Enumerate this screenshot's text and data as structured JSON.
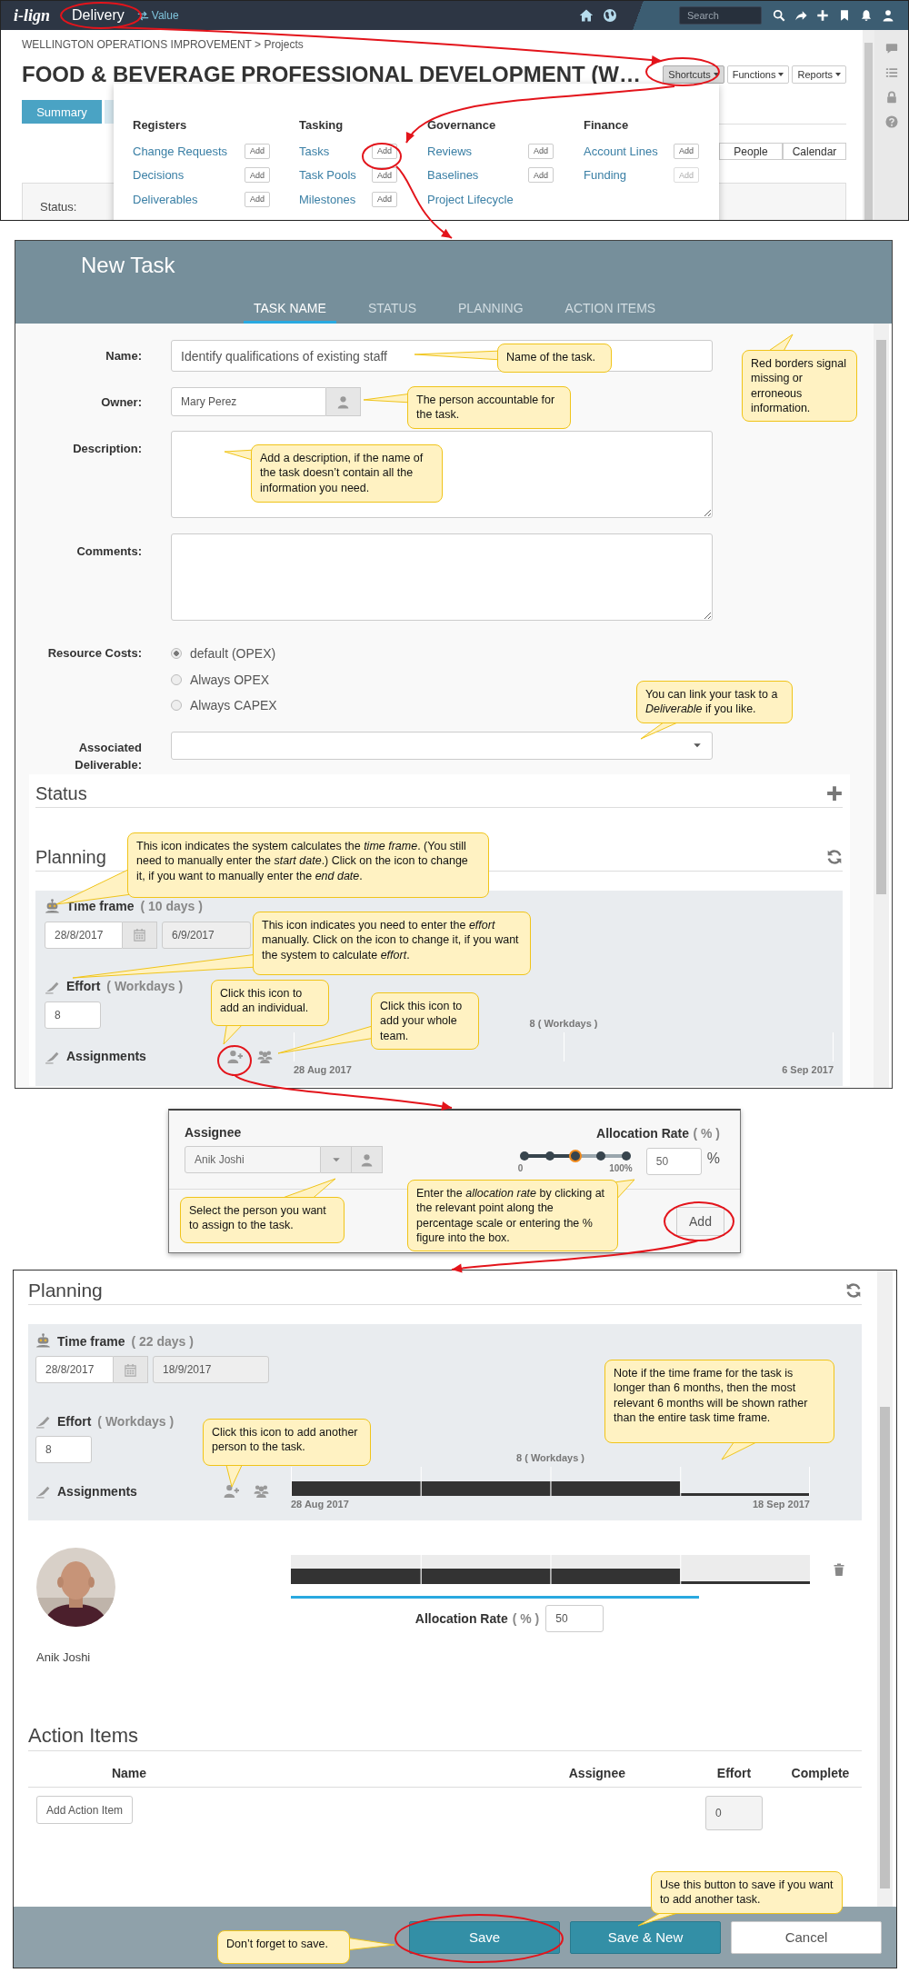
{
  "top": {
    "logo": "i-lign",
    "module": "Delivery",
    "switch_label": "Value",
    "search": {
      "placeholder": "Search"
    },
    "breadcrumb": "WELLINGTON OPERATIONS IMPROVEMENT > Projects",
    "title": "FOOD & BEVERAGE PROFESSIONAL DEVELOPMENT (W…",
    "menu_buttons": [
      {
        "label": "Shortcuts",
        "open": true
      },
      {
        "label": "Functions",
        "open": false
      },
      {
        "label": "Reports",
        "open": false
      }
    ],
    "tabs": [
      {
        "label": "Summary",
        "selected": true
      }
    ],
    "view_buttons": [
      "People",
      "Calendar"
    ],
    "status_label": "Status:"
  },
  "shortcuts_menu": {
    "columns": [
      {
        "heading": "Registers",
        "items": [
          {
            "label": "Change Requests",
            "add": {
              "label": "Add",
              "disabled": false
            }
          },
          {
            "label": "Decisions",
            "add": {
              "label": "Add",
              "disabled": false
            }
          },
          {
            "label": "Deliverables",
            "add": {
              "label": "Add",
              "disabled": false
            }
          }
        ]
      },
      {
        "heading": "Tasking",
        "items": [
          {
            "label": "Tasks",
            "add": {
              "label": "Add",
              "disabled": false
            }
          },
          {
            "label": "Task Pools",
            "add": {
              "label": "Add",
              "disabled": false
            }
          },
          {
            "label": "Milestones",
            "add": {
              "label": "Add",
              "disabled": false
            }
          }
        ]
      },
      {
        "heading": "Governance",
        "items": [
          {
            "label": "Reviews",
            "add": {
              "label": "Add",
              "disabled": false
            }
          },
          {
            "label": "Baselines",
            "add": {
              "label": "Add",
              "disabled": false
            }
          },
          {
            "label": "Project Lifecycle"
          }
        ]
      },
      {
        "heading": "Finance",
        "items": [
          {
            "label": "Account Lines",
            "add": {
              "label": "Add",
              "disabled": false
            }
          },
          {
            "label": "Funding",
            "add": {
              "label": "Add",
              "disabled": true
            }
          }
        ]
      }
    ]
  },
  "new_task": {
    "title": "New Task",
    "tabs": [
      {
        "label": "TASK NAME",
        "selected": true
      },
      {
        "label": "STATUS",
        "selected": false
      },
      {
        "label": "PLANNING",
        "selected": false
      },
      {
        "label": "ACTION ITEMS",
        "selected": false
      }
    ],
    "name": {
      "label": "Name:",
      "value": "Identify qualifications of existing staff"
    },
    "owner": {
      "label": "Owner:",
      "value": "Mary Perez"
    },
    "description": {
      "label": "Description:"
    },
    "comments": {
      "label": "Comments:"
    },
    "resource_costs": {
      "label": "Resource Costs:",
      "options": [
        {
          "label": "default (OPEX)",
          "selected": true
        },
        {
          "label": "Always OPEX",
          "selected": false
        },
        {
          "label": "Always CAPEX",
          "selected": false
        }
      ]
    },
    "deliverable": {
      "label": "Associated Deliverable:"
    },
    "status_heading": "Status",
    "planning": {
      "heading": "Planning",
      "time_frame": {
        "label": "Time frame",
        "duration": "( 10 days )",
        "start": "28/8/2017",
        "end": "6/9/2017"
      },
      "effort": {
        "label": "Effort",
        "unit": "( Workdays )",
        "value": "8"
      },
      "assignments": {
        "label": "Assignments",
        "total": "8 ( Workdays )",
        "from": "28 Aug 2017",
        "to": "6 Sep 2017"
      }
    }
  },
  "assign_popup": {
    "assignee_label": "Assignee",
    "assignee": "Anik Joshi",
    "rate_label": "Allocation Rate",
    "rate_unit": "( % )",
    "level": 0.5,
    "scale_min": "0",
    "scale_max": "100%",
    "rate": "50",
    "percent": "%",
    "add": "Add"
  },
  "task_panel": {
    "planning": {
      "heading": "Planning",
      "time_frame": {
        "label": "Time frame",
        "duration": "( 22 days )",
        "start": "28/8/2017",
        "end": "18/9/2017"
      },
      "effort": {
        "label": "Effort",
        "unit": "( Workdays )",
        "value": "8"
      },
      "assignments": {
        "label": "Assignments",
        "total": "8 ( Workdays )",
        "from": "28 Aug 2017",
        "to": "18 Sep 2017"
      }
    },
    "assignees": [
      {
        "name": "Anik Joshi",
        "rate_label": "Allocation Rate",
        "rate_unit": "( % )",
        "rate": "50"
      }
    ],
    "action_items": {
      "heading": "Action Items",
      "columns": [
        "Name",
        "Assignee",
        "Effort",
        "Complete"
      ],
      "add_button": "Add Action Item",
      "effort": "0"
    },
    "buttons": [
      {
        "label": "Save",
        "kind": "primary"
      },
      {
        "label": "Save & New",
        "kind": "primary"
      },
      {
        "label": "Cancel",
        "kind": "secondary"
      }
    ]
  },
  "callouts": [
    {
      "text": "Name of the task."
    },
    {
      "text": "The person accountable for the task."
    },
    {
      "text": "Add a description, if the name of the task doesn’t contain all the information you need."
    },
    {
      "text": "Red borders signal missing or erroneous information."
    },
    {
      "text": "You can link your task to a *Deliverable* if you like."
    },
    {
      "text": "This icon indicates the system calculates the *time frame*.  (You still need to manually enter the *start date*.) Click on the icon to change it, if you want to manually enter the *end date*."
    },
    {
      "text": "This icon indicates you need to enter the *effort* manually. Click on the icon to change it, if you want the system to calculate *effort*."
    },
    {
      "text": "Click this icon to add an individual."
    },
    {
      "text": "Click this icon to add your whole team."
    },
    {
      "text": "Select the person you want to assign to the task."
    },
    {
      "text": "Enter the *allocation rate* by clicking at the relevant point along the percentage scale or entering the % figure into the box."
    },
    {
      "text": "Click this icon to add another person to the task."
    },
    {
      "text": "Note if the time frame for the task is longer than 6 months, then the most relevant 6 months will be shown rather than the entire task time frame."
    },
    {
      "text": "Use this button to save if you want to add another task."
    },
    {
      "text": "Don’t forget to save."
    }
  ]
}
